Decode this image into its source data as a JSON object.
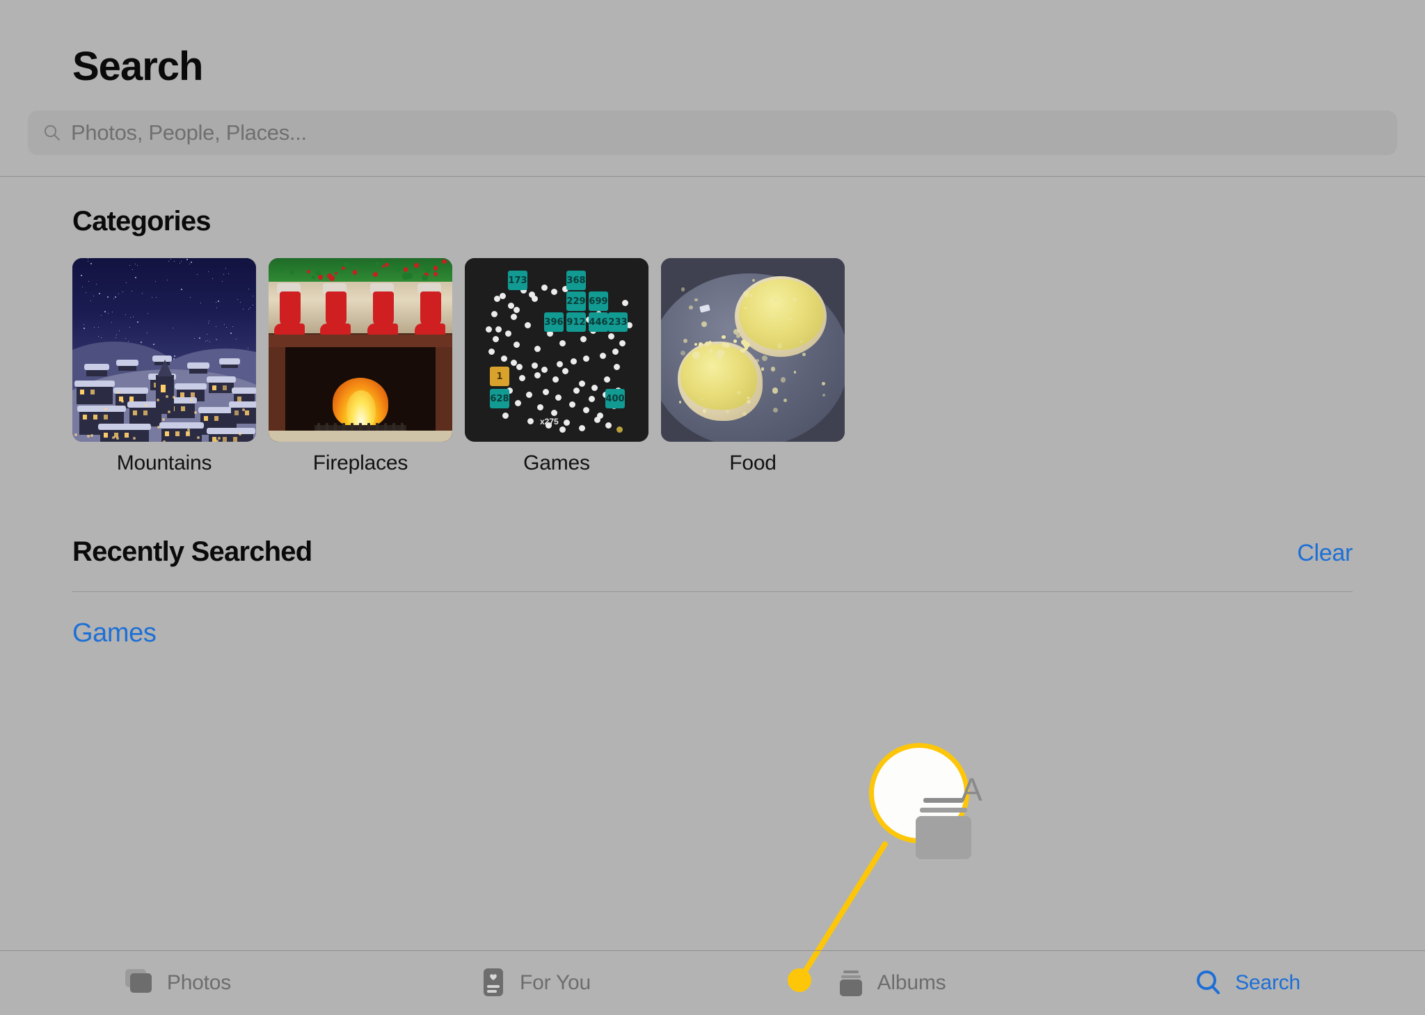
{
  "app": {
    "name": "Photos",
    "screen": "Search",
    "background_color": "#b3b3b3",
    "accent_color": "#1c6fd6",
    "callout_color": "#fdc608"
  },
  "header": {
    "title": "Search"
  },
  "search": {
    "placeholder": "Photos, People, Places...",
    "value": "",
    "icon": "search-icon"
  },
  "categories": {
    "title": "Categories",
    "items": [
      {
        "label": "Mountains",
        "thumb": "snowy-village-night-photo"
      },
      {
        "label": "Fireplaces",
        "thumb": "fireplace-stockings-photo"
      },
      {
        "label": "Games",
        "thumb": "brick-breaker-game-screenshot"
      },
      {
        "label": "Food",
        "thumb": "egg-salad-muffins-photo"
      }
    ]
  },
  "recently_searched": {
    "title": "Recently Searched",
    "clear_label": "Clear",
    "items": [
      {
        "label": "Games"
      }
    ]
  },
  "callout": {
    "target_tab": "Albums",
    "magnified_icon": "albums-icon",
    "partial_letter": "A"
  },
  "tabbar": {
    "tabs": [
      {
        "label": "Photos",
        "icon": "photos-icon",
        "active": false
      },
      {
        "label": "For You",
        "icon": "for-you-icon",
        "active": false
      },
      {
        "label": "Albums",
        "icon": "albums-icon",
        "active": false
      },
      {
        "label": "Search",
        "icon": "search-icon",
        "active": true
      }
    ]
  },
  "games_thumbnail": {
    "multiplier_label": "x275",
    "blocks": [
      {
        "value": "173",
        "color": "teal"
      },
      {
        "value": "368",
        "color": "teal"
      },
      {
        "value": "229",
        "color": "teal"
      },
      {
        "value": "699",
        "color": "teal"
      },
      {
        "value": "396",
        "color": "teal"
      },
      {
        "value": "912",
        "color": "teal"
      },
      {
        "value": "446",
        "color": "teal"
      },
      {
        "value": "233",
        "color": "teal"
      },
      {
        "value": "1",
        "color": "orange"
      },
      {
        "value": "628",
        "color": "teal"
      },
      {
        "value": "400",
        "color": "teal"
      }
    ]
  }
}
